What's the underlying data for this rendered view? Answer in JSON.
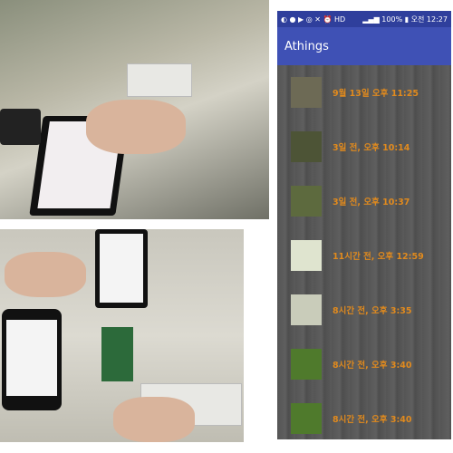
{
  "status_bar": {
    "battery": "100%",
    "time": "오전 12:27"
  },
  "app_bar": {
    "title": "Athings"
  },
  "list": [
    {
      "time": "9월 13일 오후 11:25",
      "thumb": "#6d6a55"
    },
    {
      "time": "3일 전, 오후 10:14",
      "thumb": "#4d5436"
    },
    {
      "time": "3일 전, 오후 10:37",
      "thumb": "#5d6a3e"
    },
    {
      "time": "11시간 전, 오후 12:59",
      "thumb": "#dfe4cf"
    },
    {
      "time": "8시간 전, 오후 3:35",
      "thumb": "#c9ccba"
    },
    {
      "time": "8시간 전, 오후 3:40",
      "thumb": "#4f7a2c"
    },
    {
      "time": "8시간 전, 오후 3:40",
      "thumb": "#4f7a2c"
    }
  ]
}
